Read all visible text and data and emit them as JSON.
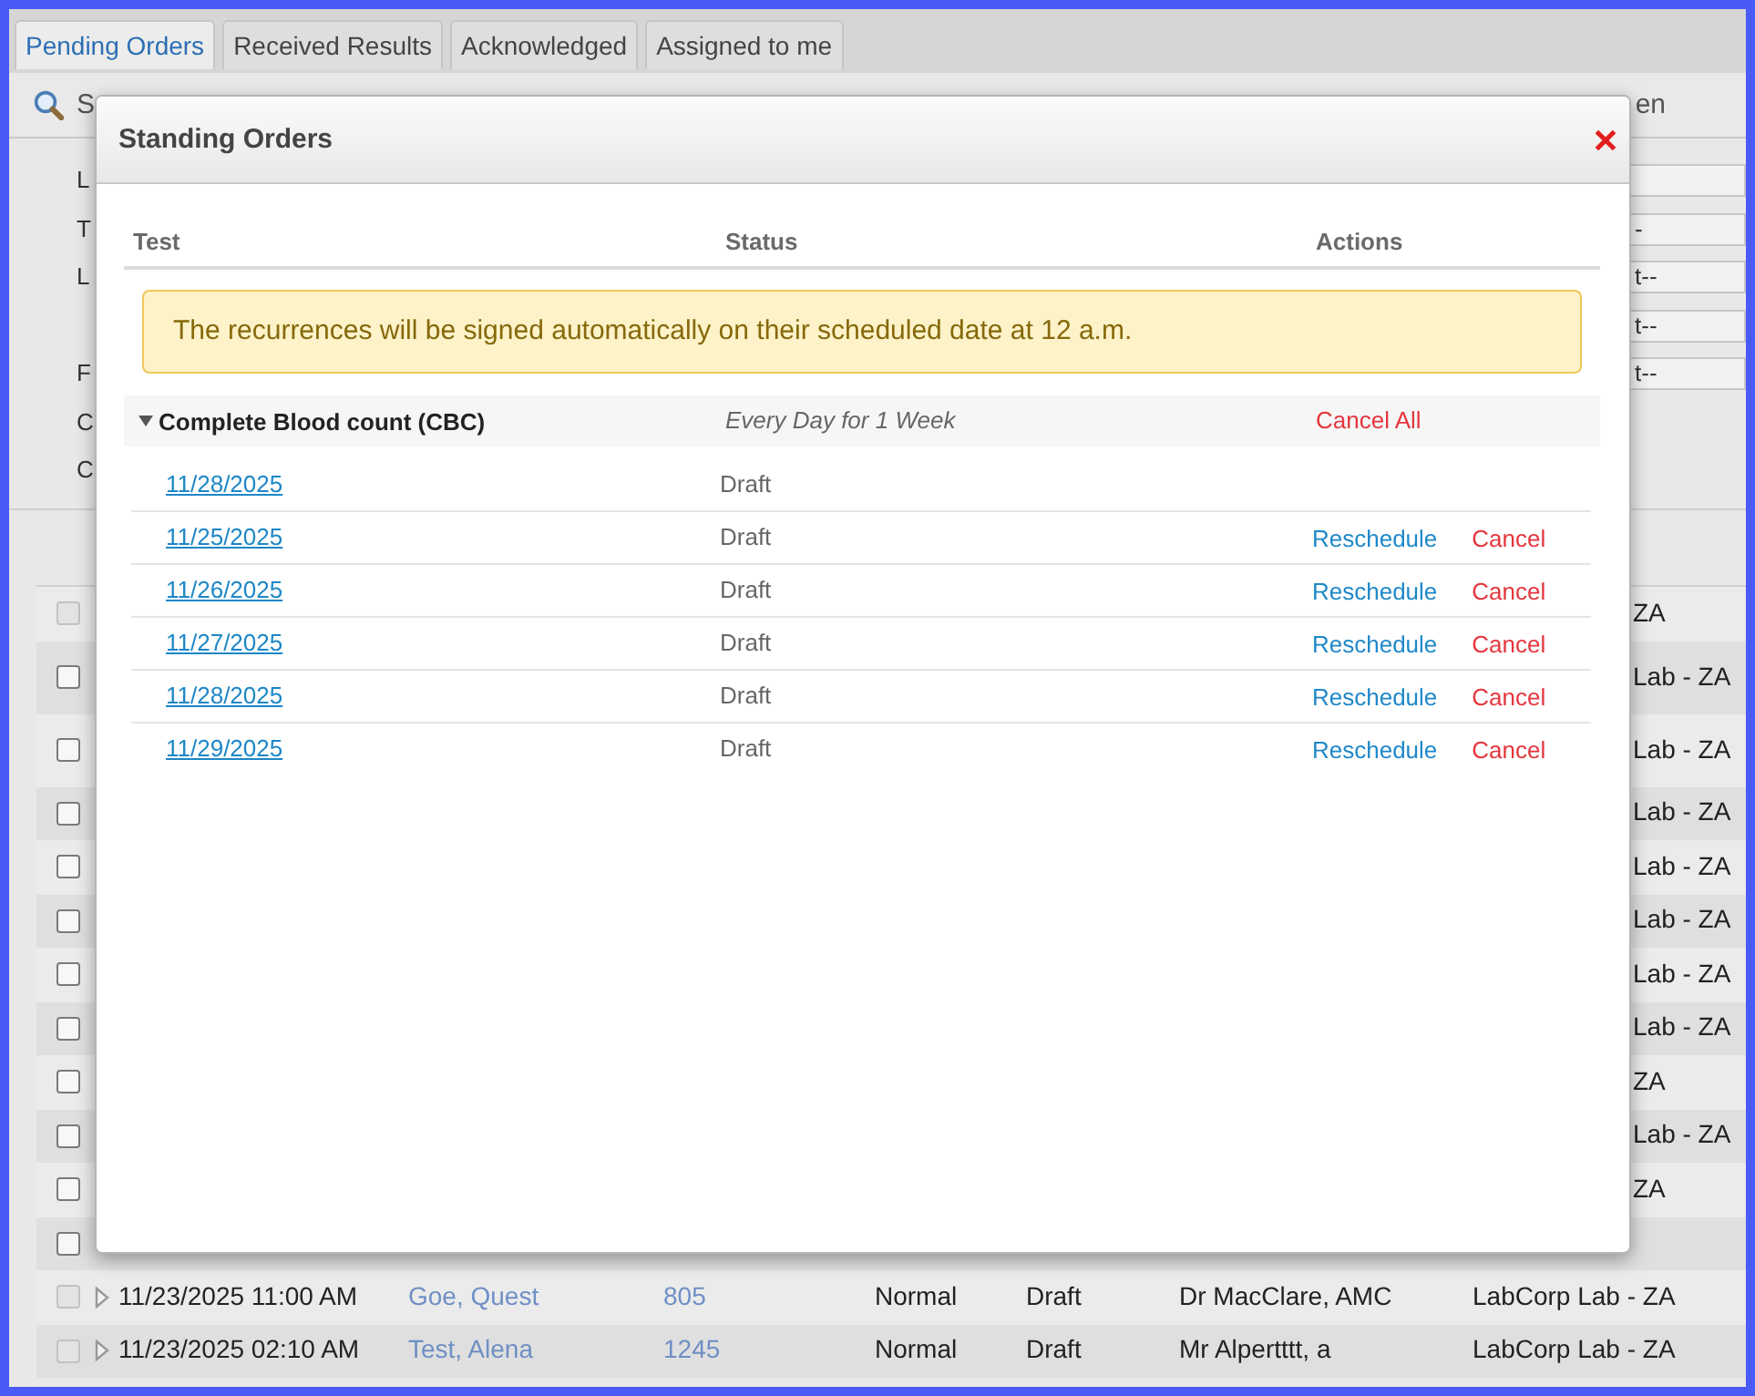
{
  "tabs": [
    {
      "label": "Pending Orders",
      "selected": true
    },
    {
      "label": "Received Results",
      "selected": false
    },
    {
      "label": "Acknowledged",
      "selected": false
    },
    {
      "label": "Assigned to me",
      "selected": false
    }
  ],
  "toolbar": {
    "left_label": "S",
    "right_label": "en"
  },
  "form": {
    "rows": [
      {
        "label": "L",
        "kind": "input"
      },
      {
        "label": "T",
        "kind": "select",
        "value": "-"
      },
      {
        "label": "L",
        "kind": "select",
        "value": "t--"
      },
      {
        "kind": "select",
        "value": "t--"
      },
      {
        "label": "F",
        "kind": "select",
        "value": "t--"
      },
      {
        "label": "C",
        "kind": "text"
      },
      {
        "label": "C",
        "kind": "text"
      }
    ]
  },
  "grid": {
    "rows": [
      {
        "kind": "covered",
        "disabled": true,
        "lab": "ZA"
      },
      {
        "kind": "covered",
        "disabled": false,
        "lab": "Lab - ZA"
      },
      {
        "kind": "covered",
        "disabled": false,
        "lab": "Lab - ZA"
      },
      {
        "kind": "covered",
        "disabled": false,
        "lab": "Lab - ZA"
      },
      {
        "kind": "covered",
        "disabled": false,
        "lab": "Lab - ZA"
      },
      {
        "kind": "covered",
        "disabled": false,
        "lab": "Lab - ZA"
      },
      {
        "kind": "covered",
        "disabled": false,
        "lab": "Lab - ZA"
      },
      {
        "kind": "covered",
        "disabled": false,
        "lab": "Lab - ZA"
      },
      {
        "kind": "covered",
        "disabled": false,
        "lab": "ZA"
      },
      {
        "kind": "covered",
        "disabled": false,
        "lab": "Lab - ZA"
      },
      {
        "kind": "covered",
        "disabled": false,
        "lab": "ZA"
      },
      {
        "kind": "covered",
        "disabled": false
      },
      {
        "kind": "full",
        "disabled": true,
        "date": "11/23/2025 11:00 AM",
        "patient": "Goe, Quest",
        "number": "805",
        "priority": "Normal",
        "status": "Draft",
        "provider": "Dr MacClare, AMC",
        "lab": "LabCorp Lab - ZA"
      },
      {
        "kind": "full",
        "disabled": true,
        "date": "11/23/2025 02:10 AM",
        "patient": "Test, Alena",
        "number": "1245",
        "priority": "Normal",
        "status": "Draft",
        "provider": "Mr Alpertttt, a",
        "lab": "LabCorp Lab - ZA"
      }
    ]
  },
  "modal": {
    "title": "Standing Orders",
    "columns": [
      "Test",
      "Status",
      "Actions"
    ],
    "notice": "The recurrences will be signed automatically on their scheduled date at 12 a.m.",
    "groups": [
      {
        "name": "Complete Blood count (CBC)",
        "expanded": true,
        "schedule": "Every Day for 1 Week",
        "action": {
          "label": "Cancel All",
          "kind": "cancel"
        },
        "occurrences": [
          {
            "date": "11/28/2025",
            "status": "Draft"
          },
          {
            "date": "11/25/2025",
            "status": "Draft",
            "actions": [
              {
                "label": "Reschedule",
                "kind": "reschedule"
              },
              {
                "label": "Cancel",
                "kind": "cancel"
              }
            ]
          },
          {
            "date": "11/26/2025",
            "status": "Draft",
            "actions": [
              {
                "label": "Reschedule",
                "kind": "reschedule"
              },
              {
                "label": "Cancel",
                "kind": "cancel"
              }
            ]
          },
          {
            "date": "11/27/2025",
            "status": "Draft",
            "actions": [
              {
                "label": "Reschedule",
                "kind": "reschedule"
              },
              {
                "label": "Cancel",
                "kind": "cancel"
              }
            ]
          },
          {
            "date": "11/28/2025",
            "status": "Draft",
            "actions": [
              {
                "label": "Reschedule",
                "kind": "reschedule"
              },
              {
                "label": "Cancel",
                "kind": "cancel"
              }
            ]
          },
          {
            "date": "11/29/2025",
            "status": "Draft",
            "actions": [
              {
                "label": "Reschedule",
                "kind": "reschedule"
              },
              {
                "label": "Cancel",
                "kind": "cancel"
              }
            ]
          }
        ]
      }
    ]
  }
}
